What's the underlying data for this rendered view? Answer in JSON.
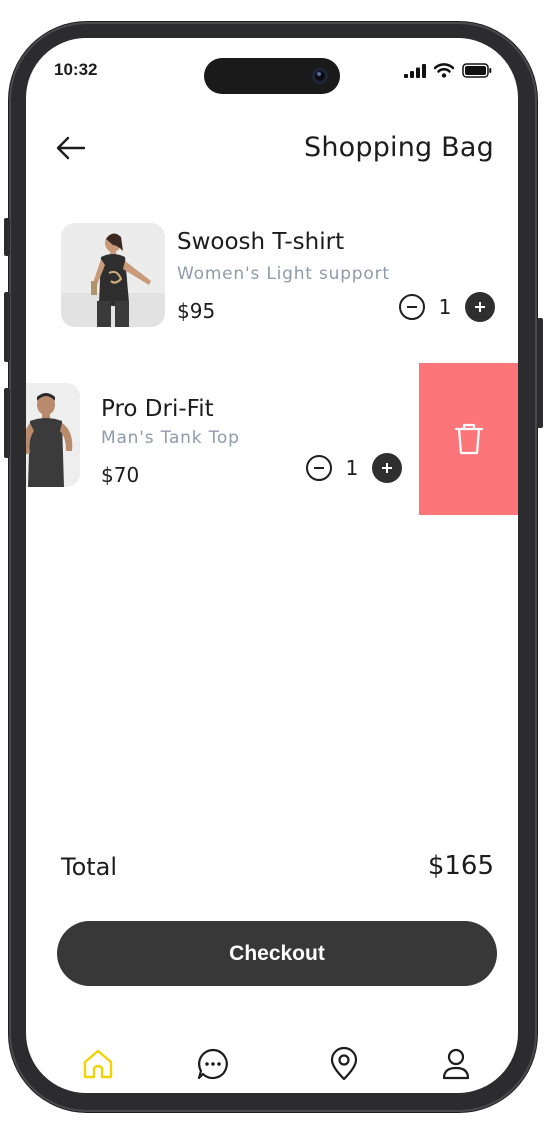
{
  "status_bar": {
    "time": "10:32"
  },
  "header": {
    "title": "Shopping Bag"
  },
  "cart": {
    "items": [
      {
        "name": "Swoosh T-shirt",
        "subtitle": "Women's Light support",
        "price": "$95",
        "quantity": "1"
      },
      {
        "name": "Pro Dri-Fit",
        "subtitle": "Man's Tank Top",
        "price": "$70",
        "quantity": "1"
      }
    ]
  },
  "summary": {
    "total_label": "Total",
    "total_value": "$165"
  },
  "checkout": {
    "label": "Checkout"
  },
  "tabbar": {
    "tabs": [
      "home-icon",
      "chat-icon",
      "location-icon",
      "profile-icon"
    ],
    "active_color": "#f2d200"
  },
  "colors": {
    "delete_bg": "#fb7579",
    "button_dark": "#383838",
    "subtitle": "#8f9aab"
  }
}
